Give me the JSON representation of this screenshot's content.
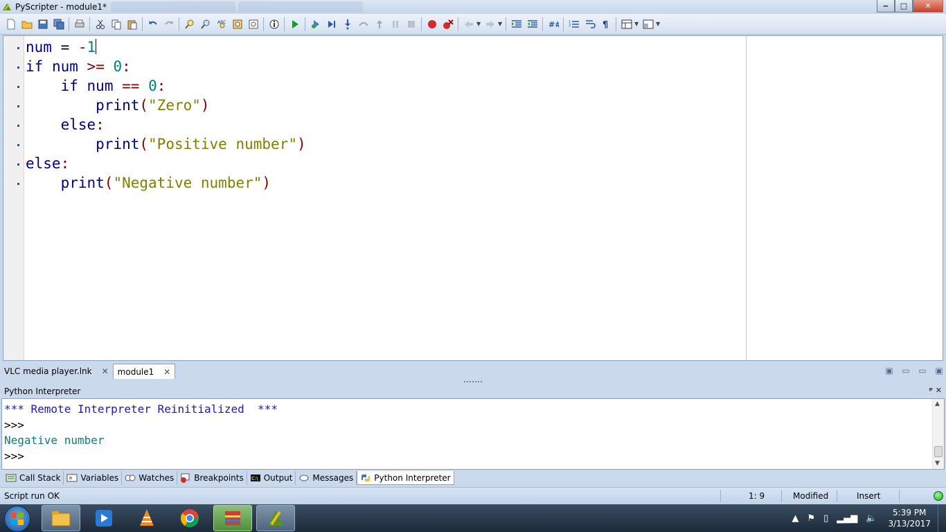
{
  "window": {
    "title": "PyScripter - module1*",
    "controls": {
      "minimize": "‒",
      "maximize": "□",
      "close": "✕"
    }
  },
  "editor": {
    "lines": [
      {
        "parts": [
          [
            "id",
            "num"
          ],
          [
            "plain",
            " = "
          ],
          [
            "op",
            "-"
          ],
          [
            "num",
            "1"
          ]
        ],
        "caret": true
      },
      {
        "parts": [
          [
            "kw",
            "if"
          ],
          [
            "plain",
            " "
          ],
          [
            "id",
            "num"
          ],
          [
            "plain",
            " "
          ],
          [
            "op",
            ">="
          ],
          [
            "plain",
            " "
          ],
          [
            "num",
            "0"
          ],
          [
            "op",
            ":"
          ]
        ]
      },
      {
        "parts": [
          [
            "plain",
            "    "
          ],
          [
            "kw",
            "if"
          ],
          [
            "plain",
            " "
          ],
          [
            "id",
            "num"
          ],
          [
            "plain",
            " "
          ],
          [
            "op",
            "=="
          ],
          [
            "plain",
            " "
          ],
          [
            "num",
            "0"
          ],
          [
            "op",
            ":"
          ]
        ]
      },
      {
        "parts": [
          [
            "plain",
            "        "
          ],
          [
            "id",
            "print"
          ],
          [
            "op",
            "("
          ],
          [
            "str",
            "\"Zero\""
          ],
          [
            "op",
            ")"
          ]
        ]
      },
      {
        "parts": [
          [
            "plain",
            "    "
          ],
          [
            "kw",
            "else"
          ],
          [
            "op",
            ":"
          ]
        ]
      },
      {
        "parts": [
          [
            "plain",
            "        "
          ],
          [
            "id",
            "print"
          ],
          [
            "op",
            "("
          ],
          [
            "str",
            "\"Positive number\""
          ],
          [
            "op",
            ")"
          ]
        ]
      },
      {
        "parts": [
          [
            "kw",
            "else"
          ],
          [
            "op",
            ":"
          ]
        ]
      },
      {
        "parts": [
          [
            "plain",
            "    "
          ],
          [
            "id",
            "print"
          ],
          [
            "op",
            "("
          ],
          [
            "str",
            "\"Negative number\""
          ],
          [
            "op",
            ")"
          ]
        ]
      }
    ]
  },
  "doc_tabs": [
    {
      "label": "VLC media player.lnk",
      "close": "✕",
      "active": false
    },
    {
      "label": "module1",
      "close": "✕",
      "active": true
    }
  ],
  "interpreter": {
    "header": "Python Interpreter",
    "header_controls": "ᵖ ✕",
    "lines": [
      {
        "text": "*** Remote Interpreter Reinitialized  ***",
        "style": "blue"
      },
      {
        "text": ">>>",
        "style": "plain"
      },
      {
        "text": "Negative number",
        "style": "teal"
      },
      {
        "text": ">>>",
        "style": "plain"
      }
    ]
  },
  "bottom_tabs": [
    {
      "label": "Call Stack",
      "icon": "call-stack-icon"
    },
    {
      "label": "Variables",
      "icon": "variables-icon"
    },
    {
      "label": "Watches",
      "icon": "watches-icon"
    },
    {
      "label": "Breakpoints",
      "icon": "breakpoints-icon"
    },
    {
      "label": "Output",
      "icon": "output-icon"
    },
    {
      "label": "Messages",
      "icon": "messages-icon"
    },
    {
      "label": "Python Interpreter",
      "icon": "python-icon",
      "active": true
    }
  ],
  "status": {
    "message": "Script run OK",
    "position": "1: 9",
    "modified": "Modified",
    "mode": "Insert"
  },
  "taskbar": {
    "time": "5:39 PM",
    "date": "3/13/2017"
  },
  "colors": {
    "keyword": "#000080",
    "number": "#008080",
    "operator": "#800000",
    "string": "#808000",
    "interp_blue": "#1818c8",
    "interp_teal": "#117a73"
  }
}
